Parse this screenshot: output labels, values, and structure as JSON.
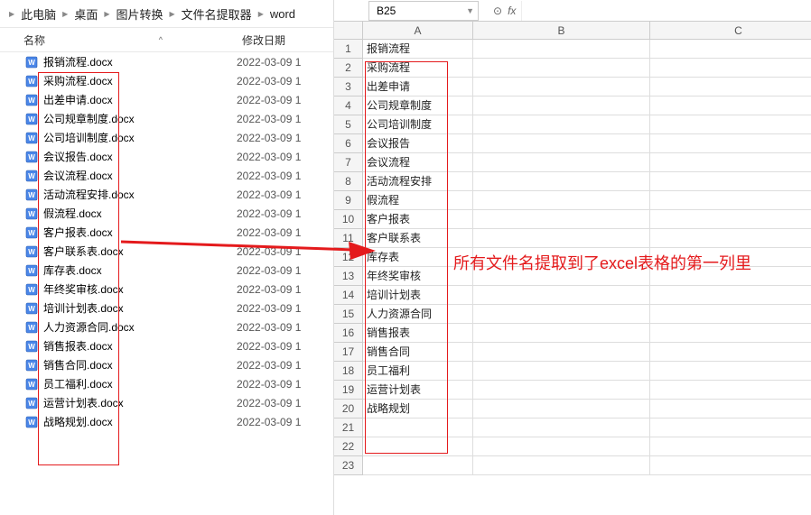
{
  "breadcrumb": {
    "items": [
      "此电脑",
      "桌面",
      "图片转换",
      "文件名提取器",
      "word"
    ]
  },
  "explorer": {
    "header_name": "名称",
    "header_date": "修改日期",
    "files": [
      {
        "name": "报销流程.docx",
        "date": "2022-03-09 1"
      },
      {
        "name": "采购流程.docx",
        "date": "2022-03-09 1"
      },
      {
        "name": "出差申请.docx",
        "date": "2022-03-09 1"
      },
      {
        "name": "公司规章制度.docx",
        "date": "2022-03-09 1"
      },
      {
        "name": "公司培训制度.docx",
        "date": "2022-03-09 1"
      },
      {
        "name": "会议报告.docx",
        "date": "2022-03-09 1"
      },
      {
        "name": "会议流程.docx",
        "date": "2022-03-09 1"
      },
      {
        "name": "活动流程安排.docx",
        "date": "2022-03-09 1"
      },
      {
        "name": "假流程.docx",
        "date": "2022-03-09 1"
      },
      {
        "name": "客户报表.docx",
        "date": "2022-03-09 1"
      },
      {
        "name": "客户联系表.docx",
        "date": "2022-03-09 1"
      },
      {
        "name": "库存表.docx",
        "date": "2022-03-09 1"
      },
      {
        "name": "年终奖审核.docx",
        "date": "2022-03-09 1"
      },
      {
        "name": "培训计划表.docx",
        "date": "2022-03-09 1"
      },
      {
        "name": "人力资源合同.docx",
        "date": "2022-03-09 1"
      },
      {
        "name": "销售报表.docx",
        "date": "2022-03-09 1"
      },
      {
        "name": "销售合同.docx",
        "date": "2022-03-09 1"
      },
      {
        "name": "员工福利.docx",
        "date": "2022-03-09 1"
      },
      {
        "name": "运营计划表.docx",
        "date": "2022-03-09 1"
      },
      {
        "name": "战略规划.docx",
        "date": "2022-03-09 1"
      }
    ]
  },
  "sheet": {
    "name_box": "B25",
    "columns": [
      "A",
      "B",
      "C"
    ],
    "cells_a": [
      "报销流程",
      "采购流程",
      "出差申请",
      "公司规章制度",
      "公司培训制度",
      "会议报告",
      "会议流程",
      "活动流程安排",
      "假流程",
      "客户报表",
      "客户联系表",
      "库存表",
      "年终奖审核",
      "培训计划表",
      "人力资源合同",
      "销售报表",
      "销售合同",
      "员工福利",
      "运营计划表",
      "战略规划"
    ],
    "total_rows": 23
  },
  "annotation": {
    "text": "所有文件名提取到了excel表格的第一列里"
  }
}
